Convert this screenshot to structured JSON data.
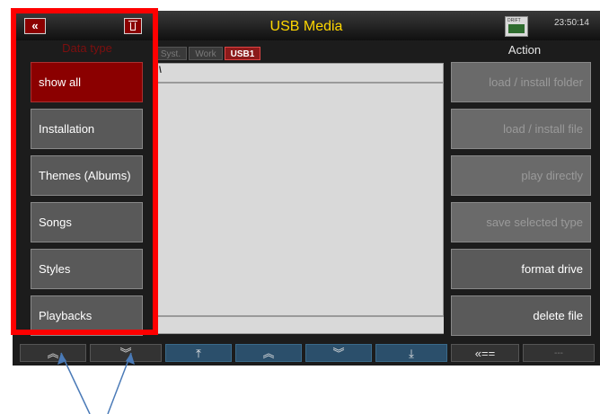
{
  "header": {
    "title": "USB Media",
    "clock": "23:50:14",
    "device_label": "DRIFT",
    "back_icon": "double-chevron-left-icon",
    "trash_icon": "trash-icon"
  },
  "left_panel": {
    "label": "Data type",
    "items": [
      {
        "label": "show all",
        "active": true
      },
      {
        "label": "Installation",
        "active": false
      },
      {
        "label": "Themes (Albums)",
        "active": false
      },
      {
        "label": "Songs",
        "active": false
      },
      {
        "label": "Styles",
        "active": false
      },
      {
        "label": "Playbacks",
        "active": false
      }
    ]
  },
  "tabs": [
    {
      "label": "Syst.",
      "active": false
    },
    {
      "label": "Work",
      "active": false
    },
    {
      "label": "USB1",
      "active": true
    }
  ],
  "file_list": {
    "path": "\\",
    "items": []
  },
  "right_panel": {
    "label": "Action",
    "items": [
      {
        "label": "load / install folder",
        "enabled": false
      },
      {
        "label": "load / install file",
        "enabled": false
      },
      {
        "label": "play directly",
        "enabled": false
      },
      {
        "label": "save selected type",
        "enabled": false
      },
      {
        "label": "format drive",
        "enabled": true
      },
      {
        "label": "delete file",
        "enabled": true
      }
    ]
  },
  "bottom_bar": [
    {
      "label": "«",
      "icon": "double-chevron-up-icon"
    },
    {
      "label": "»",
      "icon": "double-chevron-down-icon"
    },
    {
      "label": "⌅",
      "icon": "scroll-to-top-icon"
    },
    {
      "label": "«",
      "icon": "double-chevron-up-icon"
    },
    {
      "label": "»",
      "icon": "double-chevron-down-icon"
    },
    {
      "label": "⌄",
      "icon": "scroll-to-bottom-icon"
    },
    {
      "label": "<<==",
      "icon": "back-arrow-icon"
    },
    {
      "label": "---",
      "icon": "placeholder-icon"
    }
  ],
  "colors": {
    "highlight": "#ff0000",
    "active_red": "#8b0000",
    "title_yellow": "#ffd700",
    "annotation_blue": "#4a7ab7"
  }
}
